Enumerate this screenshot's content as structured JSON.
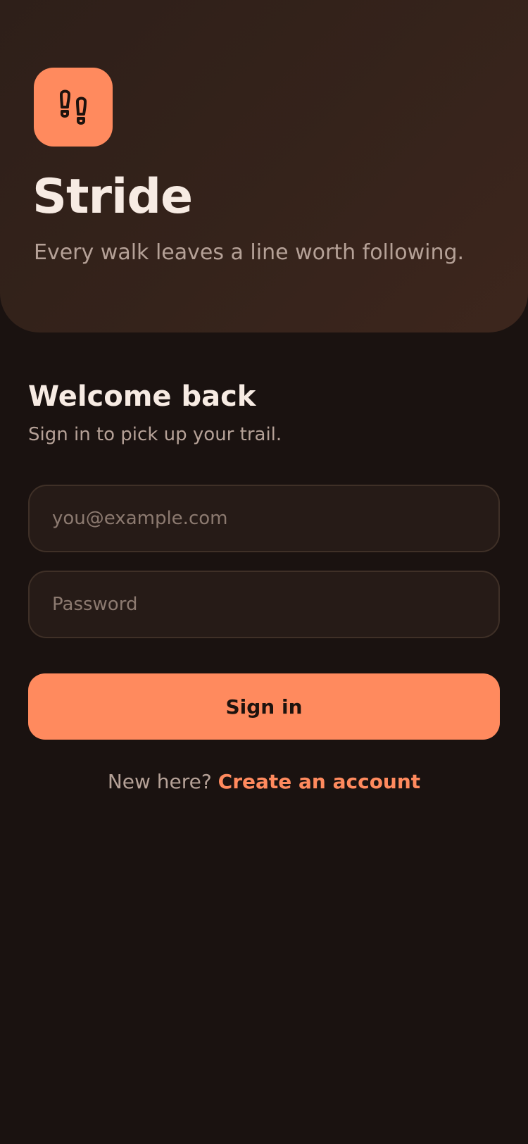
{
  "app": {
    "name": "Stride",
    "tagline": "Every walk leaves a line worth following.",
    "logo_icon": "footprints-icon",
    "accent_color": "#ff8a5e",
    "background_color": "#1a1210"
  },
  "login": {
    "heading": "Welcome back",
    "subtitle": "Sign in to pick up your trail.",
    "email": {
      "value": "",
      "placeholder": "you@example.com"
    },
    "password": {
      "value": "",
      "placeholder": "Password"
    },
    "submit_label": "Sign in"
  },
  "signup": {
    "prompt": "New here?",
    "link_label": "Create an account"
  }
}
